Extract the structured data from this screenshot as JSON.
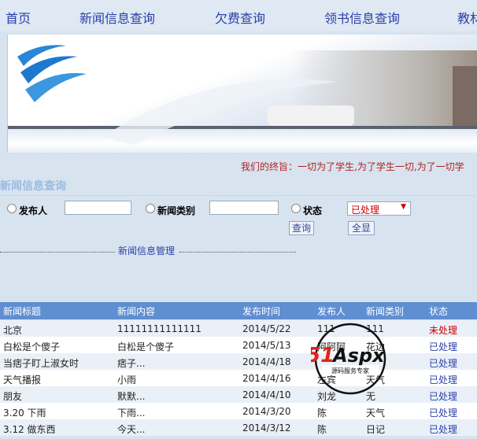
{
  "nav": {
    "items": [
      "首页",
      "新闻信息查询",
      "欠费查询",
      "领书信息查询",
      "教材"
    ]
  },
  "motto": "我们的终旨：一切为了学生,为了学生一切,为了一切学",
  "section_title": "新闻信息查询",
  "search": {
    "publisher_label": "发布人",
    "publisher_value": "",
    "category_label": "新闻类别",
    "category_value": "",
    "status_label": "状态",
    "status_selected": "已处理",
    "query_button": "查询",
    "all_button": "全显"
  },
  "management_title": "新闻信息管理",
  "table": {
    "headers": [
      "新闻标题",
      "新闻内容",
      "发布时间",
      "发布人",
      "新闻类别",
      "状态"
    ],
    "rows": [
      [
        "北京",
        "11111111111111",
        "2014/5/22",
        "111",
        "111",
        "未处理"
      ],
      [
        "白松是个傻子",
        "白松是个傻子",
        "2014/5/13",
        "阿阿阿",
        "花边",
        "已处理"
      ],
      [
        "当痞子盯上淑女时",
        "痞子...",
        "2014/4/18",
        "",
        "",
        "已处理"
      ],
      [
        "天气播报",
        "小雨",
        "2014/4/16",
        "左宾",
        "天气",
        "已处理"
      ],
      [
        "朋友",
        "默默...",
        "2014/4/10",
        "刘龙",
        "无",
        "已处理"
      ],
      [
        "3.20 下雨",
        "下雨...",
        "2014/3/20",
        "陈",
        "天气",
        "已处理"
      ],
      [
        "3.12 做东西",
        "今天...",
        "2014/3/12",
        "陈",
        "日记",
        "已处理"
      ]
    ]
  },
  "watermark": {
    "brand": "51Aspx",
    "tagline": "源码服务专家"
  },
  "colors": {
    "page_bg": "#d7e3ef",
    "nav_link": "#2b3fa8",
    "table_header": "#5f8ed1",
    "status_pending": "#cc0000",
    "status_done": "#2b3fa8",
    "motto": "#b22222"
  }
}
